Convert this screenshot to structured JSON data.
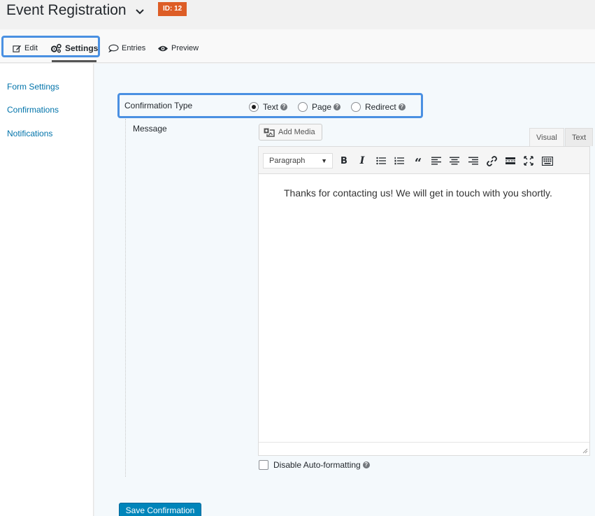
{
  "header": {
    "form_title": "Event Registration",
    "id_badge": "ID: 12",
    "badge_color": "#dd5d26"
  },
  "tabs": {
    "edit": "Edit",
    "settings": "Settings",
    "entries": "Entries",
    "preview": "Preview",
    "active": "settings"
  },
  "sidebar": {
    "items": [
      {
        "label": "Form Settings"
      },
      {
        "label": "Confirmations",
        "active": true
      },
      {
        "label": "Notifications"
      }
    ]
  },
  "confirmation": {
    "type_label": "Confirmation Type",
    "options": [
      {
        "label": "Text",
        "selected": true
      },
      {
        "label": "Page",
        "selected": false
      },
      {
        "label": "Redirect",
        "selected": false
      }
    ],
    "message_label": "Message",
    "add_media_label": "Add Media",
    "editor_tabs": {
      "visual": "Visual",
      "text": "Text",
      "active": "visual"
    },
    "format_select": "Paragraph",
    "message_text": "Thanks for contacting us! We will get in touch with you shortly.",
    "disable_autoformat_label": "Disable Auto-formatting",
    "disable_autoformat_checked": false,
    "save_label": "Save Confirmation"
  },
  "icons": {
    "toolbar": [
      "bold-icon",
      "italic-icon",
      "bullet-list-icon",
      "numbered-list-icon",
      "blockquote-icon",
      "align-left-icon",
      "align-center-icon",
      "align-right-icon",
      "link-icon",
      "read-more-icon",
      "fullscreen-icon",
      "toolbar-toggle-icon"
    ]
  },
  "colors": {
    "link": "#0073aa",
    "highlight": "#4a90e2",
    "primary_button": "#0085ba"
  }
}
